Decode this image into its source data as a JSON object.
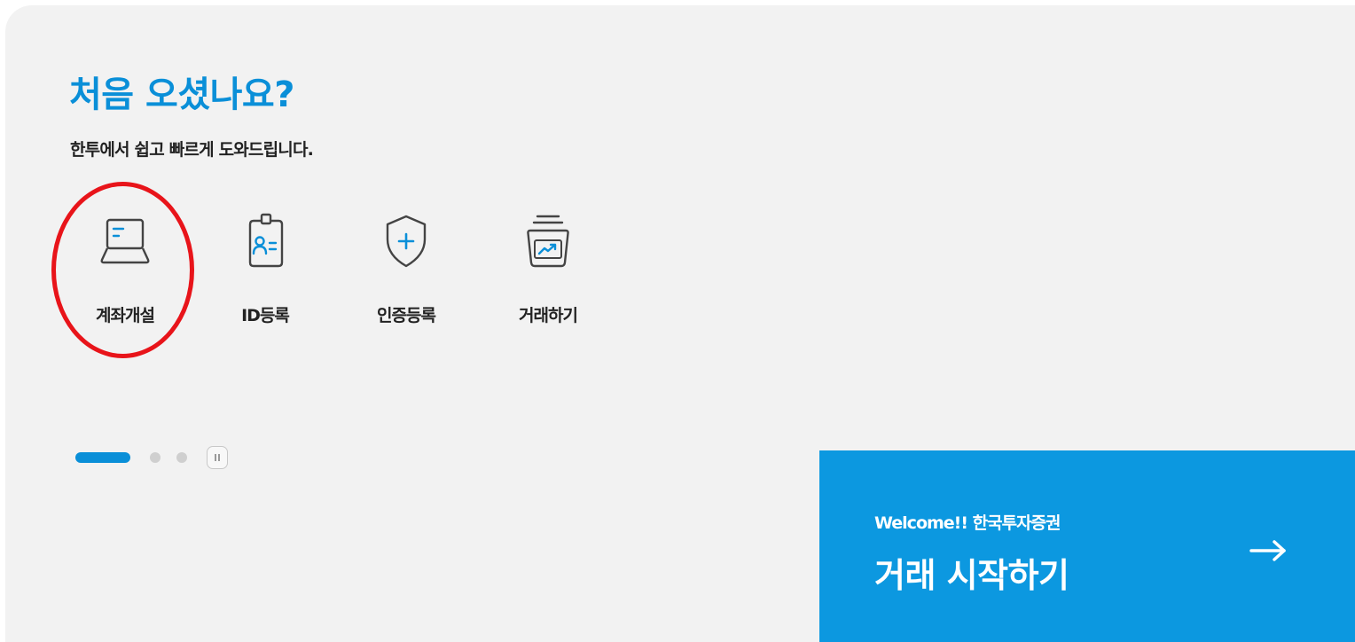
{
  "hero": {
    "title": "처음 오셨나요?",
    "subtitle": "한투에서 쉽고 빠르게 도와드립니다."
  },
  "menu": {
    "items": [
      {
        "label": "계좌개설",
        "icon": "laptop-icon",
        "highlighted": true
      },
      {
        "label": "ID등록",
        "icon": "id-card-icon",
        "highlighted": false
      },
      {
        "label": "인증등록",
        "icon": "shield-plus-icon",
        "highlighted": false
      },
      {
        "label": "거래하기",
        "icon": "trading-stack-icon",
        "highlighted": false
      }
    ]
  },
  "pager": {
    "active_index": 0,
    "total": 3,
    "control": "pause-icon"
  },
  "cta": {
    "welcome": "Welcome!! 한국투자증권",
    "action": "거래 시작하기",
    "icon": "arrow-right-icon"
  },
  "colors": {
    "accent": "#0a8fd8",
    "cta_background": "#0c98e0",
    "panel_background": "#f2f2f2",
    "highlight": "#e8141a",
    "text": "#222222"
  }
}
